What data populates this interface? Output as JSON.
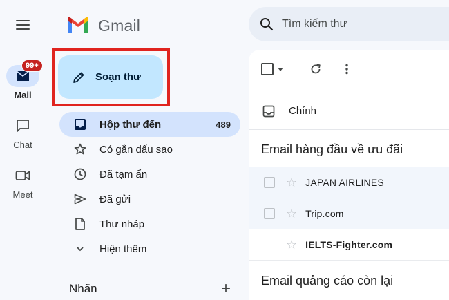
{
  "app": {
    "name": "Gmail"
  },
  "rail": {
    "items": [
      {
        "label": "Mail",
        "badge": "99+"
      },
      {
        "label": "Chat"
      },
      {
        "label": "Meet"
      }
    ]
  },
  "compose": {
    "label": "Soạn thư"
  },
  "nav": {
    "items": [
      {
        "label": "Hộp thư đến",
        "count": "489"
      },
      {
        "label": "Có gắn dấu sao"
      },
      {
        "label": "Đã tạm ẩn"
      },
      {
        "label": "Đã gửi"
      },
      {
        "label": "Thư nháp"
      },
      {
        "label": "Hiện thêm"
      }
    ]
  },
  "labels": {
    "title": "Nhãn",
    "add": "+"
  },
  "search": {
    "placeholder": "Tìm kiếm thư"
  },
  "main": {
    "tab": {
      "label": "Chính"
    },
    "sections": [
      {
        "title": "Email hàng đầu về ưu đãi",
        "rows": [
          {
            "sender": "JAPAN AIRLINES"
          },
          {
            "sender": "Trip.com"
          },
          {
            "sender": "IELTS-Fighter.com"
          }
        ]
      },
      {
        "title": "Email quảng cáo còn lại"
      }
    ]
  },
  "colors": {
    "accent": "#d3e3fd",
    "compose_bg": "#c2e7ff",
    "highlight_frame": "#e0241f",
    "badge": "#c5221f"
  }
}
